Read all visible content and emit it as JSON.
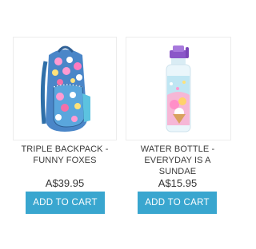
{
  "colors": {
    "button_bg": "#39a6cf",
    "button_text": "#ffffff",
    "text": "#3a3a3a",
    "border": "#ececec"
  },
  "products": [
    {
      "title_line1": "TRIPLE BACKPACK -",
      "title_line2": "FUNNY FOXES",
      "price": "A$39.95",
      "button_label": "ADD TO CART",
      "image_icon": "backpack-image"
    },
    {
      "title_line1": "WATER BOTTLE -",
      "title_line2": "EVERYDAY IS A SUNDAE",
      "price": "A$15.95",
      "button_label": "ADD TO CART",
      "image_icon": "water-bottle-image"
    }
  ]
}
